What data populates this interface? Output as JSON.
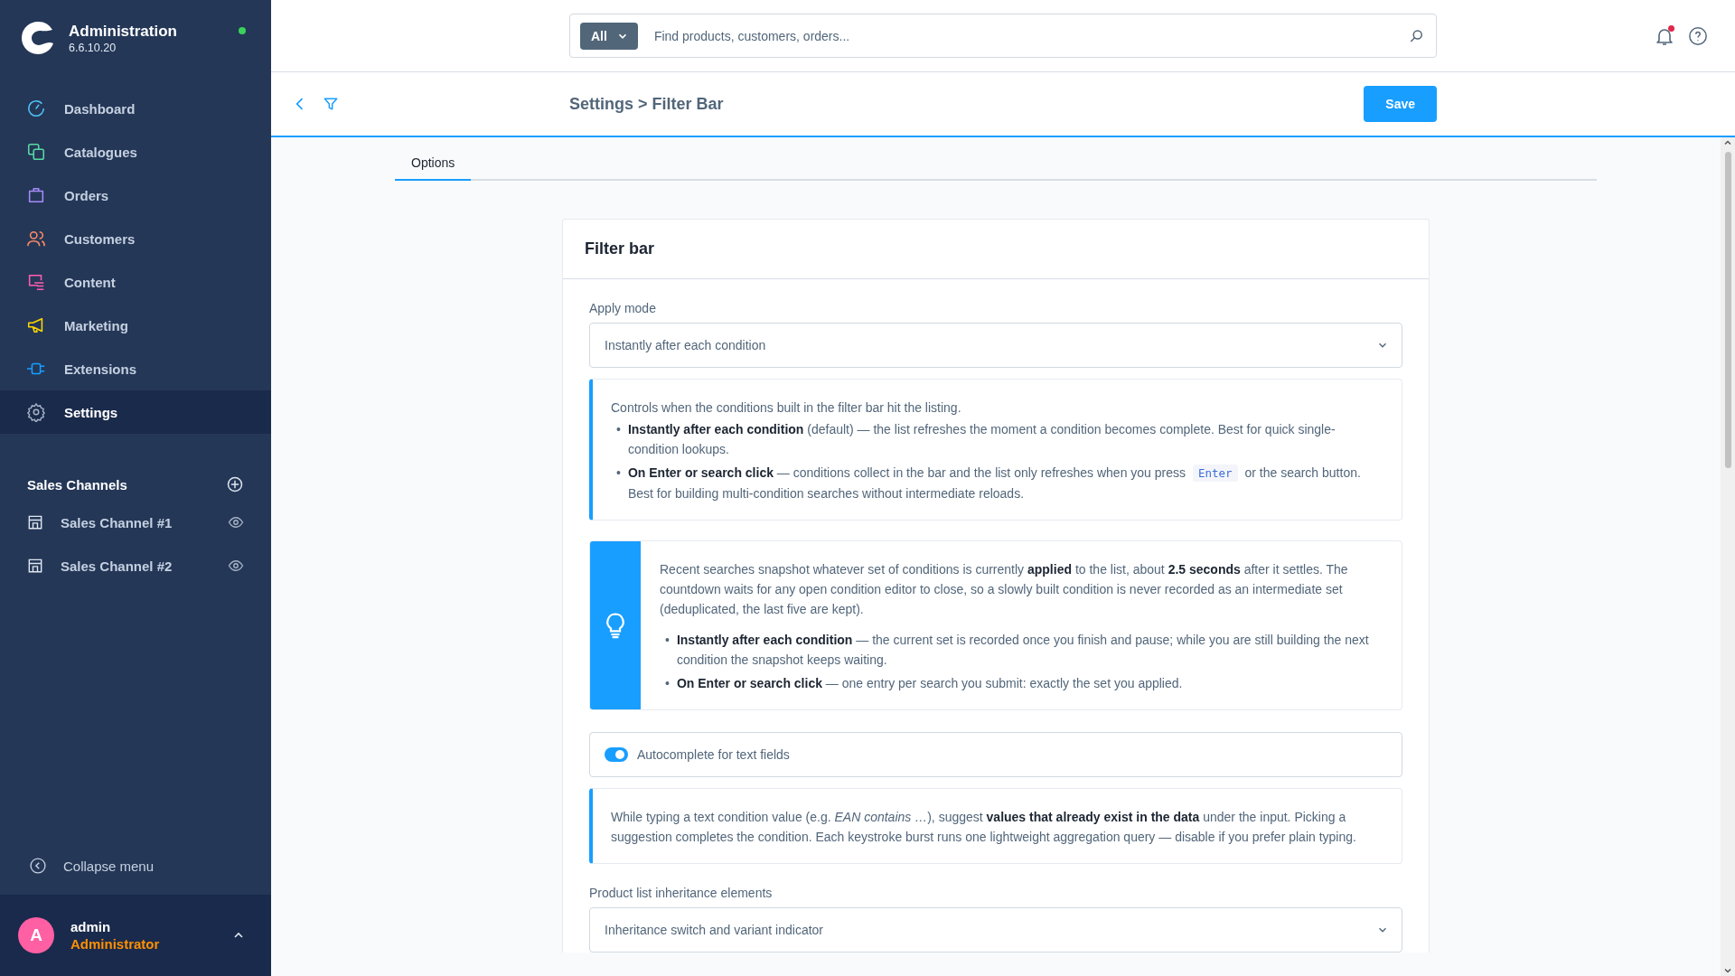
{
  "sidebar": {
    "brand": {
      "title": "Administration",
      "version": "6.6.10.20",
      "online": true
    },
    "nav": [
      {
        "label": "Dashboard",
        "selected": false
      },
      {
        "label": "Catalogues",
        "selected": false
      },
      {
        "label": "Orders",
        "selected": false
      },
      {
        "label": "Customers",
        "selected": false
      },
      {
        "label": "Content",
        "selected": false
      },
      {
        "label": "Marketing",
        "selected": false
      },
      {
        "label": "Extensions",
        "selected": false
      },
      {
        "label": "Settings",
        "selected": true
      }
    ],
    "sales_channels": {
      "title": "Sales Channels",
      "items": [
        {
          "label": "Sales Channel #1",
          "visible": true
        },
        {
          "label": "Sales Channel #2",
          "visible": true
        }
      ]
    },
    "collapse": "Collapse menu",
    "user": {
      "initial": "A",
      "name": "admin",
      "role": "Administrator",
      "expanded": false
    }
  },
  "header": {
    "search": {
      "scope": "All",
      "placeholder": "Find products, customers, orders..."
    },
    "notifications_unread": true
  },
  "page": {
    "title": "Settings > Filter Bar",
    "save": "Save"
  },
  "tabs": [
    {
      "label": "Options",
      "selected": true
    }
  ],
  "card": {
    "title": "Filter bar",
    "items": [
      {
        "kind": "select",
        "label": "Apply mode",
        "value": "Instantly after each condition"
      },
      {
        "kind": "info",
        "intro": "Controls when the conditions built in the filter bar hit the listing.",
        "bullets": [
          {
            "marker": "•",
            "parts": [
              {
                "kind": "text",
                "text": "**Instantly after each condition** (default) — the list refreshes the moment a condition becomes complete. Best for quick single-condition lookups."
              }
            ]
          },
          {
            "marker": "•",
            "parts": [
              {
                "kind": "text",
                "text": "**On Enter or search click** — conditions collect in the bar and the list only refreshes when you press "
              },
              {
                "kind": "code",
                "text": "Enter"
              },
              {
                "kind": "text",
                "text": " or the search button. Best for building multi-condition searches without intermediate reloads."
              }
            ]
          }
        ]
      },
      {
        "kind": "tip",
        "intro": "Recent searches snapshot whatever set of conditions is currently **applied** to the list, about **2.5 seconds** after it settles. The countdown waits for any open condition editor to close, so a slowly built condition is never recorded as an intermediate set (deduplicated, the last five are kept).",
        "bullets": [
          {
            "marker": "•",
            "parts": [
              {
                "kind": "text",
                "text": "**Instantly after each condition** — the current set is recorded once you finish and pause; while you are still building the next condition the snapshot keeps waiting."
              }
            ]
          },
          {
            "marker": "•",
            "parts": [
              {
                "kind": "text",
                "text": "**On Enter or search click** — one entry per search you submit: exactly the set you applied."
              }
            ]
          }
        ]
      },
      {
        "kind": "toggle",
        "label": "Autocomplete for text fields",
        "on": true
      },
      {
        "kind": "info",
        "intro": "While typing a text condition value (e.g. *EAN contains …*), suggest **values that already exist in the data** under the input. Picking a suggestion completes the condition. Each keystroke burst runs one lightweight aggregation query — disable if you prefer plain typing."
      },
      {
        "kind": "select",
        "label": "Product list inheritance elements",
        "value": "Inheritance switch and variant indicator"
      }
    ]
  }
}
